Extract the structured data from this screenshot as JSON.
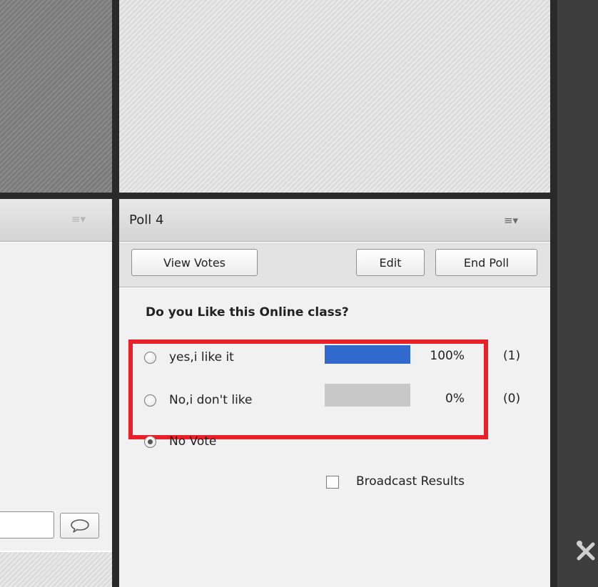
{
  "poll": {
    "title": "Poll 4",
    "buttons": {
      "view_votes": "View Votes",
      "edit": "Edit",
      "end_poll": "End Poll"
    },
    "question": "Do you Like this Online class?",
    "options": [
      {
        "label": "yes,i like it",
        "percent_text": "100%",
        "count_text": "(1)",
        "fraction": 1.0,
        "selected": false
      },
      {
        "label": "No,i don't like",
        "percent_text": "0%",
        "count_text": "(0)",
        "fraction": 0.0,
        "selected": false
      }
    ],
    "no_vote_label": "No Vote",
    "no_vote_selected": true,
    "broadcast_label": "Broadcast Results",
    "broadcast_checked": false
  },
  "icons": {
    "panel_menu": "menu-icon",
    "chat_send": "speech-bubble-icon",
    "tools": "tools-icon"
  },
  "colors": {
    "bar_fill": "#3269cc",
    "bar_track": "#c8c8c8",
    "highlight_box": "#e8202a"
  }
}
